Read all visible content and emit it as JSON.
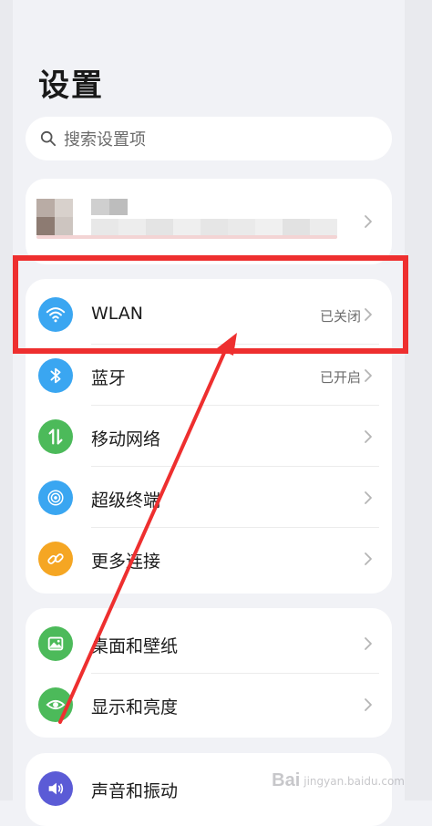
{
  "page_title": "设置",
  "search": {
    "placeholder": "搜索设置项"
  },
  "connection_items": [
    {
      "label": "WLAN",
      "value": "已关闭",
      "icon": "wifi-icon",
      "color": "#3aa6f1"
    },
    {
      "label": "蓝牙",
      "value": "已开启",
      "icon": "bluetooth-icon",
      "color": "#3aa6f1"
    },
    {
      "label": "移动网络",
      "value": "",
      "icon": "mobile-network-icon",
      "color": "#4cba5a"
    },
    {
      "label": "超级终端",
      "value": "",
      "icon": "super-device-icon",
      "color": "#3aa6f1"
    },
    {
      "label": "更多连接",
      "value": "",
      "icon": "link-icon",
      "color": "#f5a623"
    }
  ],
  "display_items": [
    {
      "label": "桌面和壁纸",
      "icon": "wallpaper-icon",
      "color": "#4cba5a"
    },
    {
      "label": "显示和亮度",
      "icon": "eye-icon",
      "color": "#4cba5a"
    }
  ],
  "sound_items": [
    {
      "label": "声音和振动",
      "icon": "speaker-icon",
      "color": "#5b5bd6"
    }
  ],
  "watermark": {
    "logo": "Bai",
    "text": "jingyan.baidu.com"
  },
  "colors": {
    "highlight": "#ee2f2f",
    "background": "#f1f2f6"
  }
}
